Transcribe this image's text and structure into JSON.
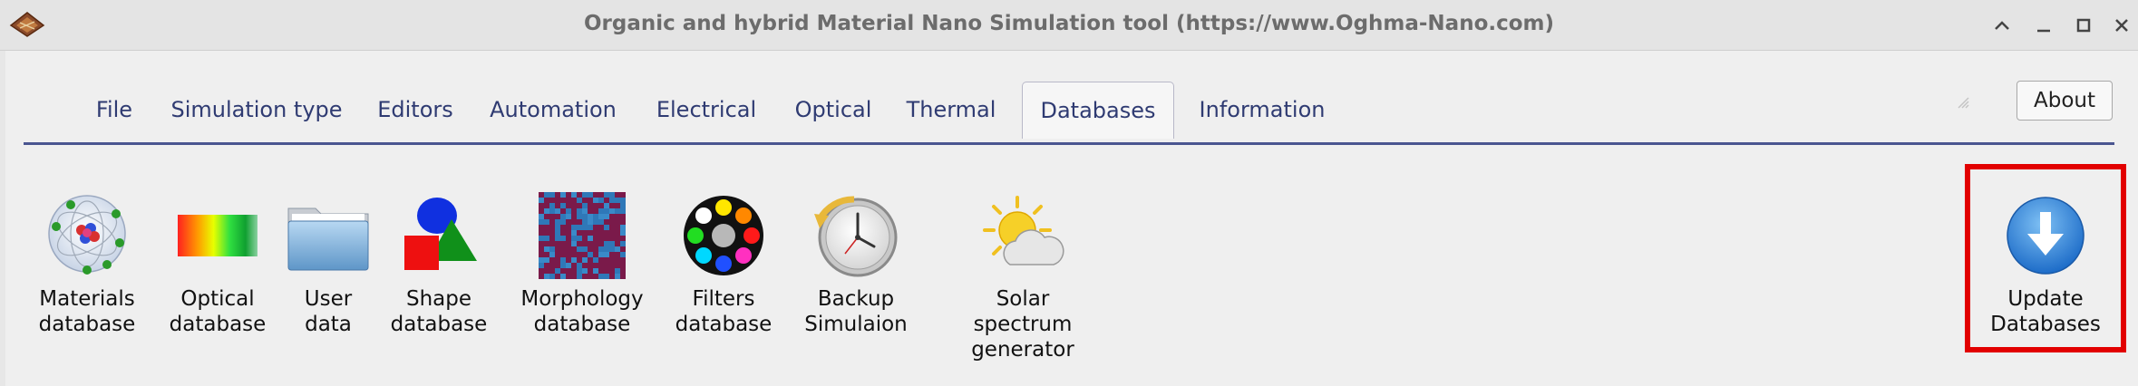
{
  "window": {
    "title": "Organic and hybrid Material Nano Simulation tool (https://www.Oghma-Nano.com)"
  },
  "tabs": [
    {
      "label": "File"
    },
    {
      "label": "Simulation type"
    },
    {
      "label": "Editors"
    },
    {
      "label": "Automation"
    },
    {
      "label": "Electrical"
    },
    {
      "label": "Optical"
    },
    {
      "label": "Thermal"
    },
    {
      "label": "Databases"
    },
    {
      "label": "Information"
    }
  ],
  "active_tab": "Databases",
  "about_label": "About",
  "tools": [
    {
      "line1": "Materials",
      "line2": "database",
      "icon": "atom-icon"
    },
    {
      "line1": "Optical",
      "line2": "database",
      "icon": "spectrum-icon"
    },
    {
      "line1": "User",
      "line2": "data",
      "icon": "folder-icon"
    },
    {
      "line1": "Shape",
      "line2": "database",
      "icon": "shapes-icon"
    },
    {
      "line1": "Morphology",
      "line2": "database",
      "icon": "morphology-icon"
    },
    {
      "line1": "Filters",
      "line2": "database",
      "icon": "filters-icon"
    },
    {
      "line1": "Backup",
      "line2": "Simulaion",
      "icon": "backup-clock-icon"
    },
    {
      "line1": "Solar spectrum",
      "line2": "generator",
      "icon": "sun-cloud-icon"
    }
  ],
  "update": {
    "line1": "Update",
    "line2": "Databases",
    "icon": "download-arrow-icon"
  },
  "colors": {
    "tab_text": "#2f3b72",
    "highlight": "#e20000",
    "update_blue": "#2e7fd6"
  }
}
